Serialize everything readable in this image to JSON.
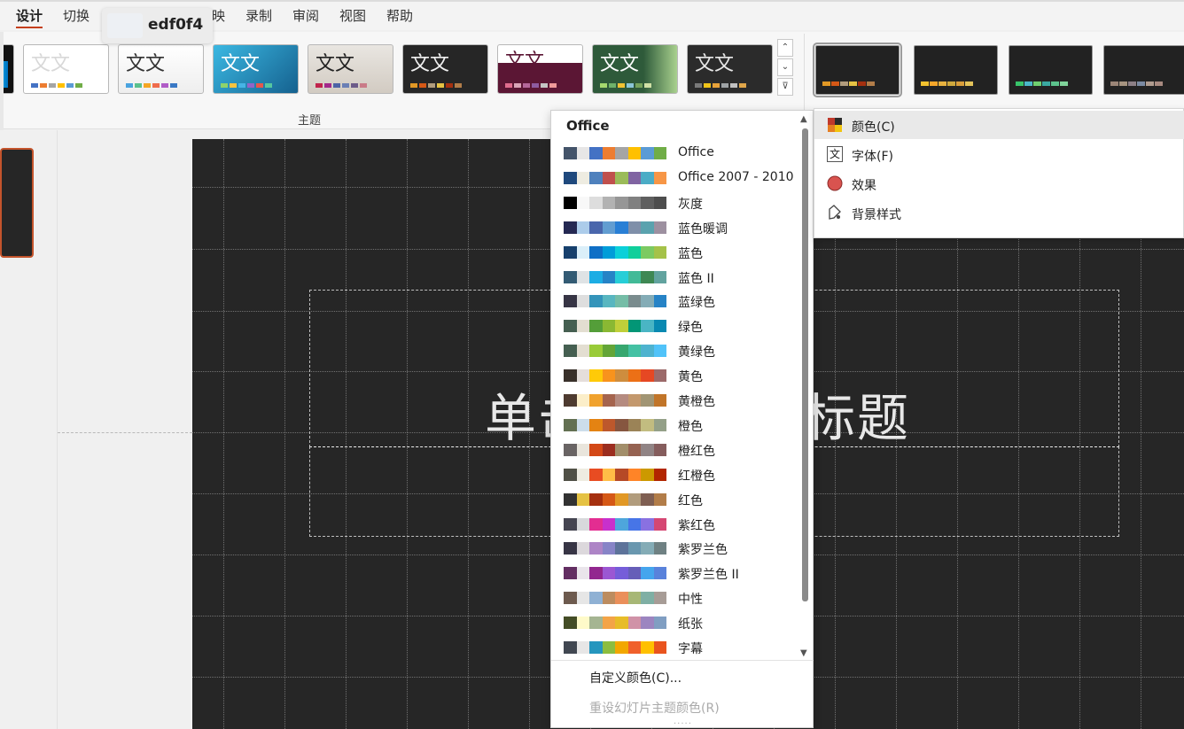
{
  "tabs": [
    "设计",
    "切换",
    "映",
    "录制",
    "审阅",
    "视图",
    "帮助"
  ],
  "tooltip": {
    "color_hex": "edf0f4"
  },
  "ribbon": {
    "group_label": "主题",
    "theme_glyph": "文文",
    "scroll_up": "⌃",
    "scroll_down": "⌄",
    "more": "⊽"
  },
  "slide": {
    "title": "单击此处添加标题"
  },
  "color_dropdown": {
    "header": "Office",
    "schemes": [
      {
        "name": "Office",
        "colors": [
          "#44546a",
          "#e7e6e6",
          "#4472c4",
          "#ed7d31",
          "#a5a5a5",
          "#ffc000",
          "#5b9bd5",
          "#70ad47"
        ]
      },
      {
        "name": "Office 2007 - 2010",
        "colors": [
          "#1f497d",
          "#eeece1",
          "#4f81bd",
          "#c0504d",
          "#9bbb59",
          "#8064a2",
          "#4bacc6",
          "#f79646"
        ]
      },
      {
        "name": "灰度",
        "colors": [
          "#000000",
          "#f8f8f8",
          "#dddddd",
          "#b2b2b2",
          "#969696",
          "#808080",
          "#5f5f5f",
          "#4d4d4d"
        ]
      },
      {
        "name": "蓝色暖调",
        "colors": [
          "#242852",
          "#acccea",
          "#4a66ac",
          "#629dd1",
          "#297fd5",
          "#7f8fa9",
          "#5aa2ae",
          "#9d90a0"
        ]
      },
      {
        "name": "蓝色",
        "colors": [
          "#17406d",
          "#dbeff9",
          "#0f6fc6",
          "#009dd9",
          "#0bd0d9",
          "#10cf9b",
          "#7cca62",
          "#a5c249"
        ]
      },
      {
        "name": "蓝色 II",
        "colors": [
          "#335b74",
          "#dfe3e5",
          "#1cade4",
          "#2683c6",
          "#27ced7",
          "#42ba97",
          "#3e8853",
          "#62a39f"
        ]
      },
      {
        "name": "蓝绿色",
        "colors": [
          "#373545",
          "#dedede",
          "#3494ba",
          "#58b6c0",
          "#75bda7",
          "#7a8c8e",
          "#84acb6",
          "#2683c6"
        ]
      },
      {
        "name": "绿色",
        "colors": [
          "#455f51",
          "#e3ded1",
          "#549e39",
          "#8ab833",
          "#c0cf3a",
          "#029676",
          "#4ab5c4",
          "#0989b1"
        ]
      },
      {
        "name": "黄绿色",
        "colors": [
          "#455f51",
          "#e3ded1",
          "#99cb38",
          "#63a537",
          "#37a76f",
          "#44c1a3",
          "#4eb3cf",
          "#51c3f9"
        ]
      },
      {
        "name": "黄色",
        "colors": [
          "#39302a",
          "#e5dedb",
          "#ffca08",
          "#f8931d",
          "#ce8d3e",
          "#ec7016",
          "#e64823",
          "#9c6a6a"
        ]
      },
      {
        "name": "黄橙色",
        "colors": [
          "#4e3b30",
          "#fbeec9",
          "#f0a22e",
          "#a5644e",
          "#b58b80",
          "#c3986d",
          "#a19574",
          "#c17529"
        ]
      },
      {
        "name": "橙色",
        "colors": [
          "#637052",
          "#ccddea",
          "#e48312",
          "#bd582c",
          "#865640",
          "#9b8357",
          "#c2bc80",
          "#94a088"
        ]
      },
      {
        "name": "橙红色",
        "colors": [
          "#696464",
          "#e9e5dc",
          "#d34817",
          "#9b2d1f",
          "#a28e6a",
          "#956251",
          "#918485",
          "#855d5d"
        ]
      },
      {
        "name": "红橙色",
        "colors": [
          "#505046",
          "#eeece1",
          "#e84c22",
          "#ffbd47",
          "#b64926",
          "#ff8427",
          "#cc9900",
          "#b22600"
        ]
      },
      {
        "name": "红色",
        "colors": [
          "#323232",
          "#e5c243",
          "#a5300f",
          "#d55816",
          "#e19825",
          "#b19c7d",
          "#7f5f52",
          "#b27d49"
        ]
      },
      {
        "name": "紫红色",
        "colors": [
          "#454551",
          "#d8d9dc",
          "#e32d91",
          "#c830cc",
          "#4ea6dc",
          "#4775e7",
          "#8971e1",
          "#d54773"
        ]
      },
      {
        "name": "紫罗兰色",
        "colors": [
          "#373545",
          "#dcd8dc",
          "#ad84c6",
          "#8784c7",
          "#5d739a",
          "#6997af",
          "#84acb6",
          "#6f8183"
        ]
      },
      {
        "name": "紫罗兰色 II",
        "colors": [
          "#632e62",
          "#eae5eb",
          "#92278f",
          "#9b57d3",
          "#755dd9",
          "#665eb8",
          "#45a5ed",
          "#5982db"
        ]
      },
      {
        "name": "中性",
        "colors": [
          "#6d5a4e",
          "#e6e6e6",
          "#8fb1d4",
          "#bc8c5f",
          "#ea8f5a",
          "#a7b776",
          "#7fafa4",
          "#a79c96"
        ]
      },
      {
        "name": "纸张",
        "colors": [
          "#444d26",
          "#fefac9",
          "#a5b592",
          "#f3a447",
          "#e7bc29",
          "#d092a7",
          "#9c85c0",
          "#809ec2"
        ]
      },
      {
        "name": "字幕",
        "colors": [
          "#414751",
          "#e7e6e6",
          "#2596be",
          "#8cbd3f",
          "#f2a700",
          "#f0602b",
          "#ffc000",
          "#e9541e"
        ]
      }
    ],
    "custom": "自定义颜色(C)...",
    "reset": "重设幻灯片主题颜色(R)",
    "grip": "....."
  },
  "variants_menu": {
    "items": [
      {
        "label": "颜色(C)",
        "icon": "color-palette-icon"
      },
      {
        "label": "字体(F)",
        "icon": "font-icon",
        "glyph": "文"
      },
      {
        "label": "效果",
        "icon": "effects-icon"
      },
      {
        "label": "背景样式",
        "icon": "background-style-icon"
      }
    ]
  },
  "colors": {
    "accent": "#c43e1c",
    "slide_bg": "#262626"
  }
}
